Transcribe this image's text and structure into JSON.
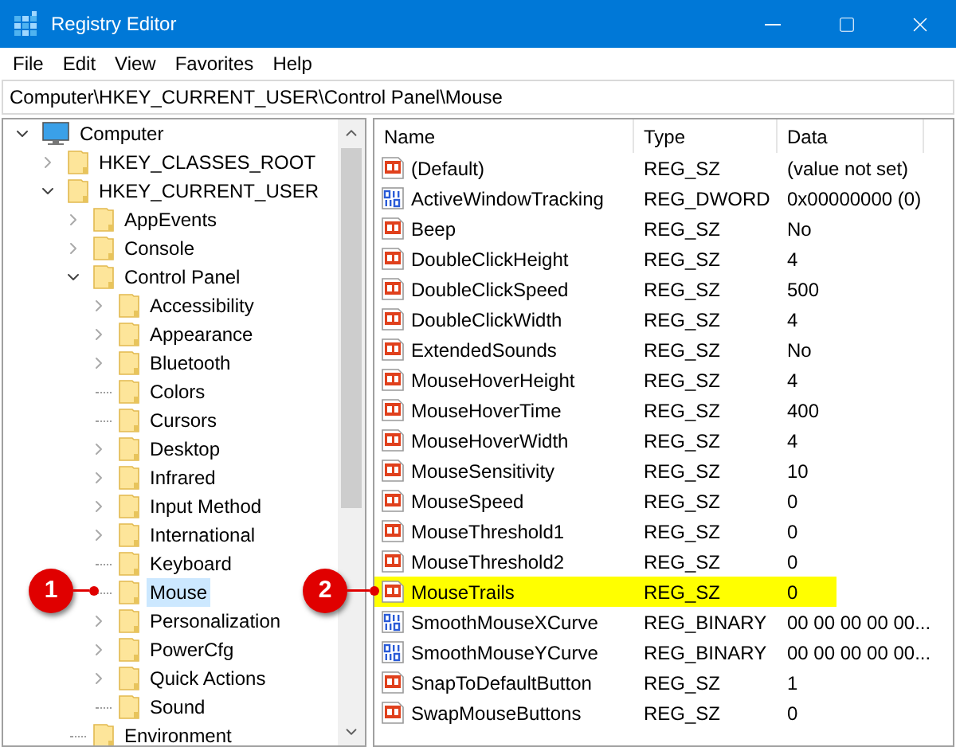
{
  "window": {
    "title": "Registry Editor"
  },
  "menu": [
    "File",
    "Edit",
    "View",
    "Favorites",
    "Help"
  ],
  "address": "Computer\\HKEY_CURRENT_USER\\Control Panel\\Mouse",
  "tree": [
    {
      "label": "Computer",
      "kind": "computer",
      "expanded": true,
      "selected": false,
      "children": [
        {
          "label": "HKEY_CLASSES_ROOT",
          "kind": "branch",
          "expanded": false,
          "selected": false
        },
        {
          "label": "HKEY_CURRENT_USER",
          "kind": "branch",
          "expanded": true,
          "selected": false,
          "children": [
            {
              "label": "AppEvents",
              "kind": "branch",
              "expanded": false,
              "selected": false
            },
            {
              "label": "Console",
              "kind": "branch",
              "expanded": false,
              "selected": false
            },
            {
              "label": "Control Panel",
              "kind": "branch",
              "expanded": true,
              "selected": false,
              "children": [
                {
                  "label": "Accessibility",
                  "kind": "branch",
                  "expanded": false,
                  "selected": false
                },
                {
                  "label": "Appearance",
                  "kind": "branch",
                  "expanded": false,
                  "selected": false
                },
                {
                  "label": "Bluetooth",
                  "kind": "branch",
                  "expanded": false,
                  "selected": false
                },
                {
                  "label": "Colors",
                  "kind": "leaf",
                  "expanded": false,
                  "selected": false
                },
                {
                  "label": "Cursors",
                  "kind": "leaf",
                  "expanded": false,
                  "selected": false
                },
                {
                  "label": "Desktop",
                  "kind": "branch",
                  "expanded": false,
                  "selected": false
                },
                {
                  "label": "Infrared",
                  "kind": "branch",
                  "expanded": false,
                  "selected": false
                },
                {
                  "label": "Input Method",
                  "kind": "branch",
                  "expanded": false,
                  "selected": false
                },
                {
                  "label": "International",
                  "kind": "branch",
                  "expanded": false,
                  "selected": false
                },
                {
                  "label": "Keyboard",
                  "kind": "leaf",
                  "expanded": false,
                  "selected": false
                },
                {
                  "label": "Mouse",
                  "kind": "leaf",
                  "expanded": false,
                  "selected": true
                },
                {
                  "label": "Personalization",
                  "kind": "branch",
                  "expanded": false,
                  "selected": false
                },
                {
                  "label": "PowerCfg",
                  "kind": "branch",
                  "expanded": false,
                  "selected": false
                },
                {
                  "label": "Quick Actions",
                  "kind": "branch",
                  "expanded": false,
                  "selected": false
                },
                {
                  "label": "Sound",
                  "kind": "leaf",
                  "expanded": false,
                  "selected": false
                }
              ]
            },
            {
              "label": "Environment",
              "kind": "leaf",
              "expanded": false,
              "selected": false
            }
          ]
        }
      ]
    }
  ],
  "table": {
    "columns": [
      "Name",
      "Type",
      "Data"
    ],
    "rows": [
      {
        "kind": "string",
        "name": "(Default)",
        "type": "REG_SZ",
        "data": "(value not set)",
        "highlighted": false
      },
      {
        "kind": "binary",
        "name": "ActiveWindowTracking",
        "type": "REG_DWORD",
        "data": "0x00000000 (0)",
        "highlighted": false
      },
      {
        "kind": "string",
        "name": "Beep",
        "type": "REG_SZ",
        "data": "No",
        "highlighted": false
      },
      {
        "kind": "string",
        "name": "DoubleClickHeight",
        "type": "REG_SZ",
        "data": "4",
        "highlighted": false
      },
      {
        "kind": "string",
        "name": "DoubleClickSpeed",
        "type": "REG_SZ",
        "data": "500",
        "highlighted": false
      },
      {
        "kind": "string",
        "name": "DoubleClickWidth",
        "type": "REG_SZ",
        "data": "4",
        "highlighted": false
      },
      {
        "kind": "string",
        "name": "ExtendedSounds",
        "type": "REG_SZ",
        "data": "No",
        "highlighted": false
      },
      {
        "kind": "string",
        "name": "MouseHoverHeight",
        "type": "REG_SZ",
        "data": "4",
        "highlighted": false
      },
      {
        "kind": "string",
        "name": "MouseHoverTime",
        "type": "REG_SZ",
        "data": "400",
        "highlighted": false
      },
      {
        "kind": "string",
        "name": "MouseHoverWidth",
        "type": "REG_SZ",
        "data": "4",
        "highlighted": false
      },
      {
        "kind": "string",
        "name": "MouseSensitivity",
        "type": "REG_SZ",
        "data": "10",
        "highlighted": false
      },
      {
        "kind": "string",
        "name": "MouseSpeed",
        "type": "REG_SZ",
        "data": "0",
        "highlighted": false
      },
      {
        "kind": "string",
        "name": "MouseThreshold1",
        "type": "REG_SZ",
        "data": "0",
        "highlighted": false
      },
      {
        "kind": "string",
        "name": "MouseThreshold2",
        "type": "REG_SZ",
        "data": "0",
        "highlighted": false
      },
      {
        "kind": "string",
        "name": "MouseTrails",
        "type": "REG_SZ",
        "data": "0",
        "highlighted": true
      },
      {
        "kind": "binary",
        "name": "SmoothMouseXCurve",
        "type": "REG_BINARY",
        "data": "00 00 00 00 00...",
        "highlighted": false
      },
      {
        "kind": "binary",
        "name": "SmoothMouseYCurve",
        "type": "REG_BINARY",
        "data": "00 00 00 00 00...",
        "highlighted": false
      },
      {
        "kind": "string",
        "name": "SnapToDefaultButton",
        "type": "REG_SZ",
        "data": "1",
        "highlighted": false
      },
      {
        "kind": "string",
        "name": "SwapMouseButtons",
        "type": "REG_SZ",
        "data": "0",
        "highlighted": false
      }
    ]
  },
  "callouts": [
    {
      "number": "1"
    },
    {
      "number": "2"
    }
  ]
}
